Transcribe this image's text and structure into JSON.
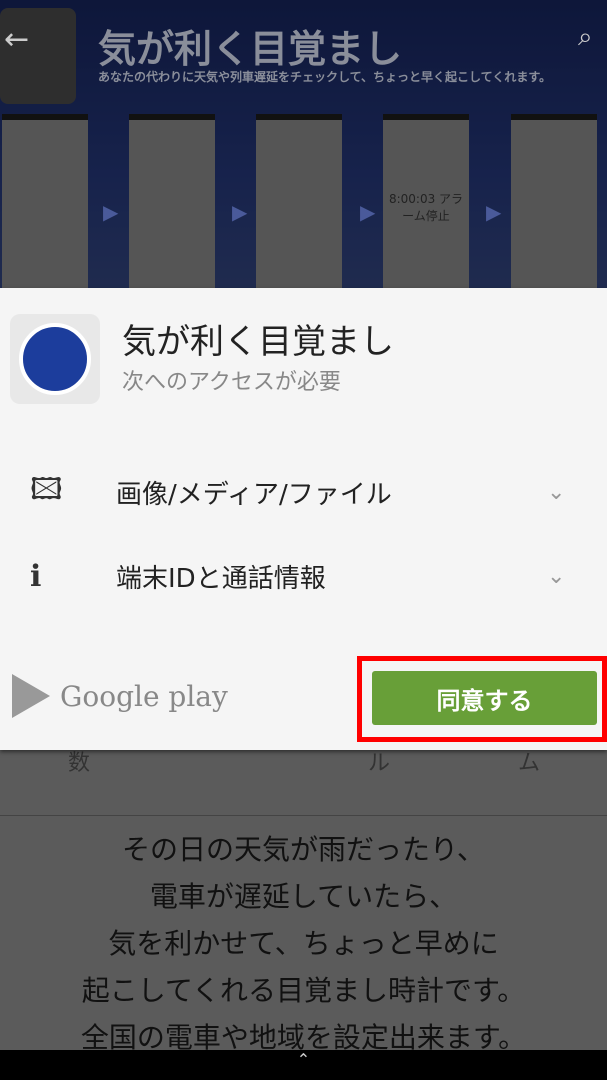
{
  "banner": {
    "title": "気が利く目覚まし",
    "subtitle": "あなたの代わりに天気や列車遅延をチェックして、ちょっと早く起こしてくれます。",
    "back_icon": "arrow-left-icon",
    "search_icon": "search-icon",
    "thumbs": [
      "",
      "",
      "",
      "8:00:03 アラーム停止",
      ""
    ]
  },
  "dialog": {
    "app_name": "気が利く目覚まし",
    "subtitle": "次へのアクセスが必要",
    "permissions": [
      {
        "label": "画像/メディア/ファイル",
        "icon": "photo-icon"
      },
      {
        "label": "端末IDと通話情報",
        "icon": "phone-info-icon"
      }
    ],
    "store_label": "Google play",
    "agree_label": "同意する",
    "agree_color": "#689f38",
    "highlight_color": "#ff0000"
  },
  "tabs": [
    "数",
    "ル",
    "ム"
  ],
  "description": [
    "その日の天気が雨だったり、",
    "電車が遅延していたら、",
    "気を利かせて、ちょっと早めに",
    "起こしてくれる目覚まし時計です。",
    "全国の電車や地域を設定出来ます。"
  ]
}
